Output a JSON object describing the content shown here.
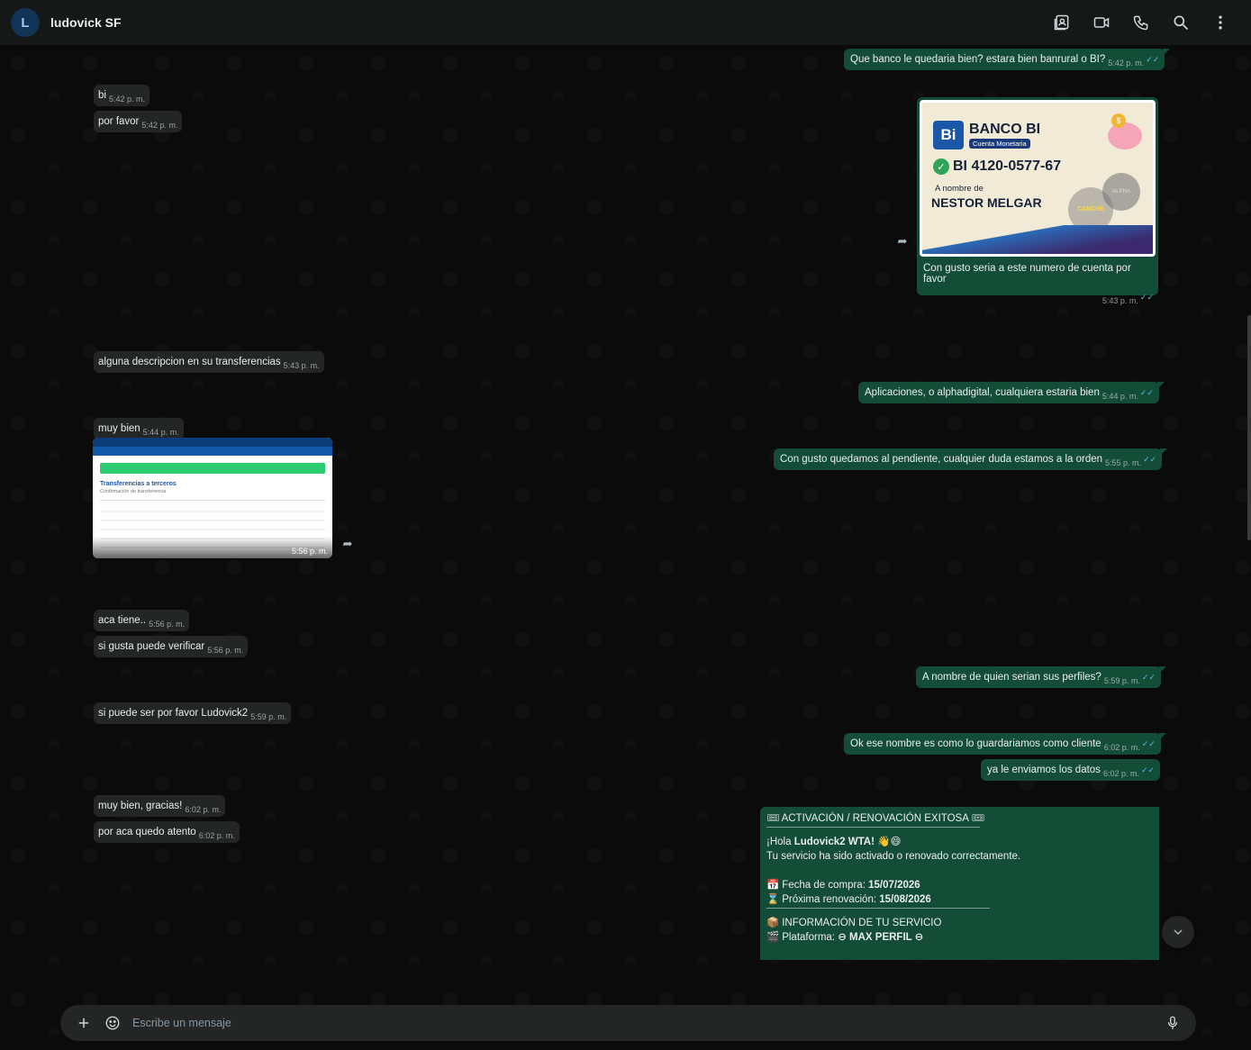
{
  "header": {
    "avatar_letter": "L",
    "contact_name": "ludovick SF"
  },
  "messages": {
    "m1": {
      "text": "Que banco le quedaria bien? estara bien banrural o BI?",
      "time": "5:42 p. m."
    },
    "m2": {
      "text": "bi",
      "time": "5:42 p. m."
    },
    "m3": {
      "text": "por favor",
      "time": "5:42 p. m."
    },
    "m4": {
      "caption": "Con gusto seria a este numero de cuenta por favor",
      "time": "5:43 p. m."
    },
    "m5": {
      "text": "alguna descripcion en su transferencias",
      "time": "5:43 p. m."
    },
    "m6": {
      "text": "Aplicaciones, o alphadigital, cualquiera estaria bien",
      "time": "5:44 p. m."
    },
    "m7": {
      "text": "muy bien",
      "time": "5:44 p. m."
    },
    "m8": {
      "text": "Con gusto quedamos al pendiente, cualquier duda estamos a la orden",
      "time": "5:55 p. m."
    },
    "m9": {
      "time": "5:56 p. m."
    },
    "m10": {
      "text": "aca tiene..",
      "time": "5:56 p. m."
    },
    "m11": {
      "text": "si gusta puede verificar",
      "time": "5:56 p. m."
    },
    "m12": {
      "text": "A nombre de quien serian sus perfiles?",
      "time": "5:59 p. m."
    },
    "m13": {
      "text": "si puede ser por favor Ludovick2",
      "time": "5:59 p. m."
    },
    "m14": {
      "text": "Ok ese nombre es como lo guardariamos como cliente",
      "time": "6:02 p. m."
    },
    "m15": {
      "text": "ya le enviamos los datos",
      "time": "6:02 p. m."
    },
    "m16": {
      "text": "muy bien, gracias!",
      "time": "6:02 p. m."
    },
    "m17": {
      "text": "por aca quedo atento",
      "time": "6:02 p. m."
    }
  },
  "bank_card": {
    "logo": "Bi",
    "title": "BANCO BI",
    "subtitle": "Cuenta Monetaria",
    "account": "BI  4120-0577-67",
    "owner_label": "A nombre de",
    "owner": "NESTOR MELGAR",
    "badge_1": "ALPHA",
    "badge_2": "CANCHE ALPHA"
  },
  "transfer_shot": {
    "title": "Transferencias a terceros",
    "subtitle": "Confirmación de transferencia"
  },
  "activation": {
    "title": "ACTIVACIÓN / RENOVACIÓN EXITOSA",
    "greeting_prefix": "¡Hola ",
    "greeting_name": "Ludovick2 WTA!",
    "greeting_line": "Tu servicio ha sido activado o renovado correctamente.",
    "purchase_label": "Fecha de compra: ",
    "purchase_date": "15/07/2026",
    "renewal_label": "Próxima renovación: ",
    "renewal_date": "15/08/2026",
    "service_title": "INFORMACIÓN DE TU SERVICIO",
    "platform_label": "Plataforma: ",
    "platform_value": "⊖ MAX PERFIL ⊖"
  },
  "composer": {
    "placeholder": "Escribe un mensaje"
  },
  "colors": {
    "incoming": "#242626",
    "outgoing": "#144d37",
    "read_tick": "#53bdeb"
  }
}
